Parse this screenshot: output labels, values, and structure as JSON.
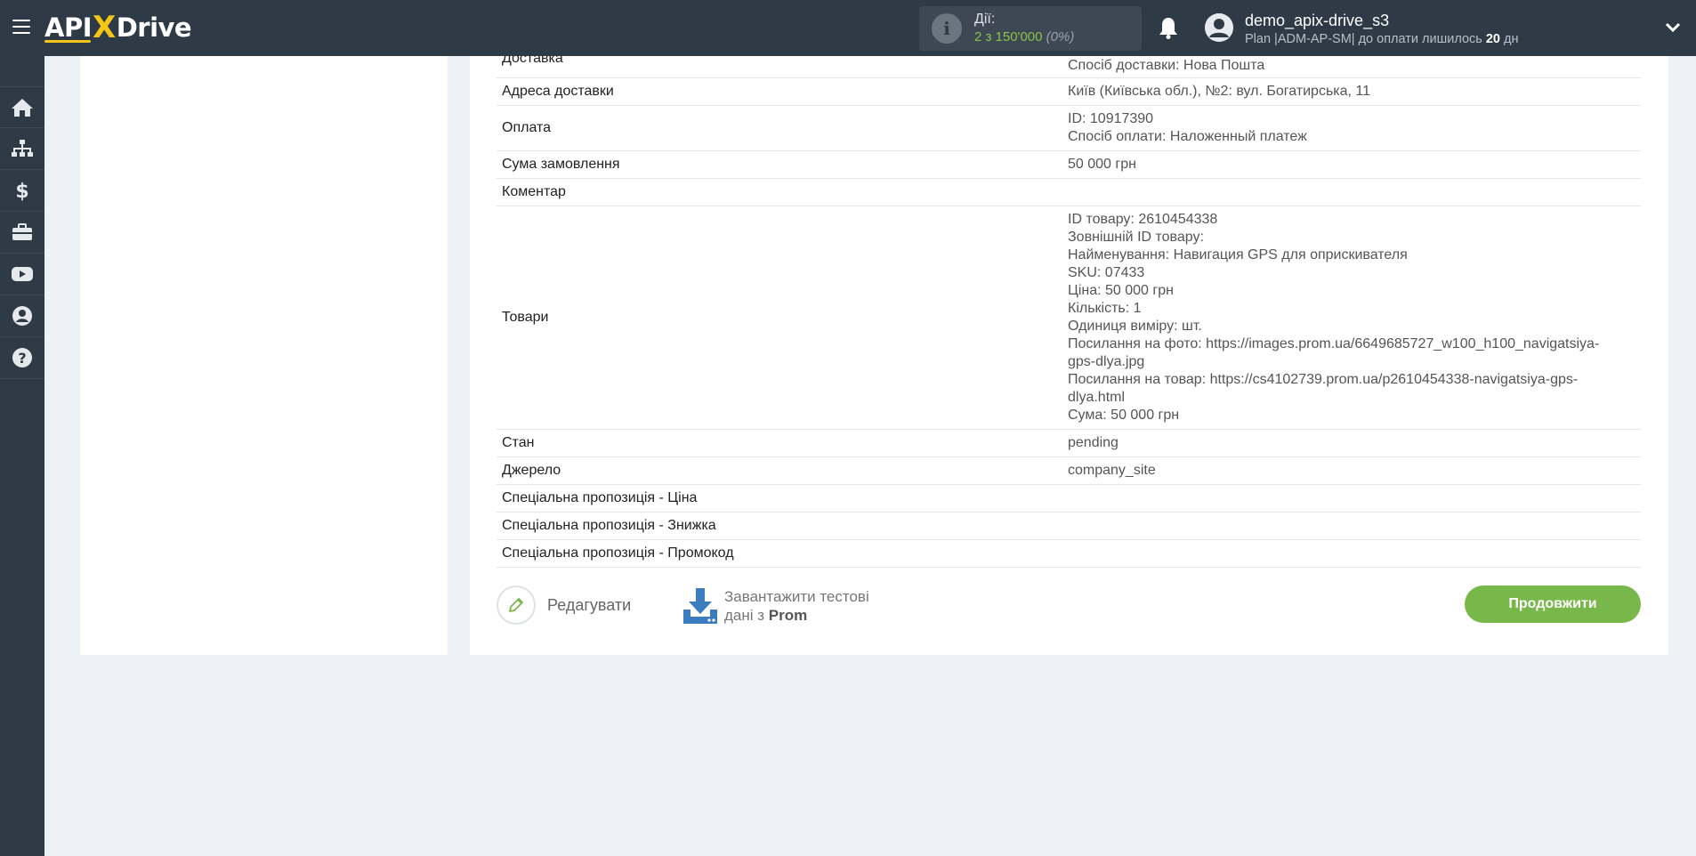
{
  "header": {
    "logo_left": "API",
    "logo_x": "X",
    "logo_right": "Drive",
    "actions_label": "Дії:",
    "actions_count": "2 з 150'000",
    "actions_percent": "(0%)",
    "user_name": "demo_apix-drive_s3",
    "plan_text": "Plan |ADM-AP-SM| до оплати лишилось",
    "plan_days": "20",
    "plan_days_unit": "дн"
  },
  "sidebar": {
    "items": [
      "home-icon",
      "sitemap-icon",
      "dollar-icon",
      "briefcase-icon",
      "youtube-icon",
      "user-circle-icon",
      "help-icon"
    ]
  },
  "table": {
    "partial_top_key": "Доставка",
    "partial_top_value": "Спосіб доставки: Нова Пошта",
    "rows": [
      {
        "key": "Адреса доставки",
        "values": [
          "Київ (Київська обл.), №2: вул. Богатирська, 11"
        ]
      },
      {
        "key": "Оплата",
        "values": [
          "ID: 10917390",
          "Спосіб оплати: Наложенный платеж"
        ]
      },
      {
        "key": "Сума замовлення",
        "values": [
          "50 000 грн"
        ]
      },
      {
        "key": "Коментар",
        "values": [
          ""
        ]
      },
      {
        "key": "Товари",
        "values": [
          "ID товару: 2610454338",
          "Зовнішній ID товару:",
          "Найменування: Навигация GPS для оприскивателя",
          "SKU: 07433",
          "Ціна: 50 000 грн",
          "Кількість: 1",
          "Одиниця виміру: шт.",
          "Посилання на фото: https://images.prom.ua/6649685727_w100_h100_navigatsiya-",
          "gps-dlya.jpg",
          "Посилання на товар: https://cs4102739.prom.ua/p2610454338-navigatsiya-gps-",
          "dlya.html",
          "Сума: 50 000 грн"
        ]
      },
      {
        "key": "Стан",
        "values": [
          "pending"
        ]
      },
      {
        "key": "Джерело",
        "values": [
          "company_site"
        ]
      },
      {
        "key": "Спеціальна пропозиція - Ціна",
        "values": [
          ""
        ]
      },
      {
        "key": "Спеціальна пропозиція - Знижка",
        "values": [
          ""
        ]
      },
      {
        "key": "Спеціальна пропозиція - Промокод",
        "values": [
          ""
        ]
      }
    ]
  },
  "buttons": {
    "edit": "Редагувати",
    "download_line1": "Завантажити тестові",
    "download_line2": "дані з",
    "download_source": "Prom",
    "continue": "Продовжити"
  },
  "colors": {
    "topbar": "#2e3a46",
    "accent_green": "#78b74a",
    "logo_yellow": "#f5c518",
    "download_blue": "#3b7dbf"
  }
}
